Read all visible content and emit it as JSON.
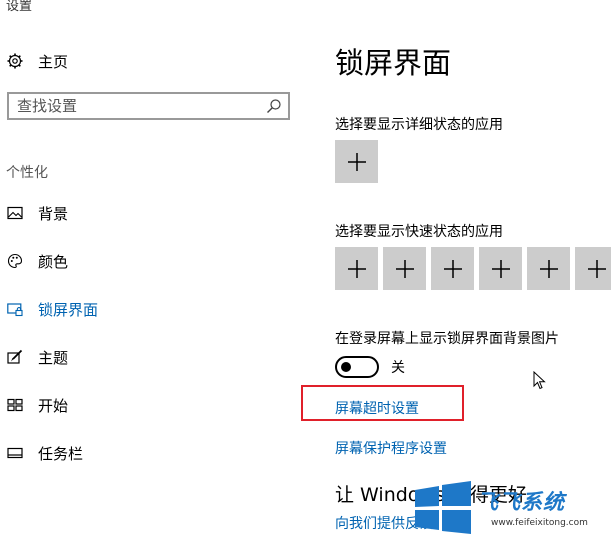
{
  "window": {
    "title": "设置"
  },
  "sidebar": {
    "home_label": "主页",
    "search_placeholder": "查找设置",
    "section_label": "个性化",
    "items": [
      {
        "label": "背景",
        "icon": "picture-icon",
        "active": false
      },
      {
        "label": "颜色",
        "icon": "palette-icon",
        "active": false
      },
      {
        "label": "锁屏界面",
        "icon": "lock-screen-icon",
        "active": true
      },
      {
        "label": "主题",
        "icon": "theme-brush-icon",
        "active": false
      },
      {
        "label": "开始",
        "icon": "start-menu-icon",
        "active": false
      },
      {
        "label": "任务栏",
        "icon": "taskbar-icon",
        "active": false
      }
    ]
  },
  "main": {
    "title": "锁屏界面",
    "detailed_status_label": "选择要显示详细状态的应用",
    "quick_status_label": "选择要显示快速状态的应用",
    "background_toggle_label": "在登录屏幕上显示锁屏界面背景图片",
    "background_toggle_state": "关",
    "screen_timeout_link": "屏幕超时设置",
    "screensaver_link": "屏幕保护程序设置",
    "make_better_heading": "让 Windows 变得更好",
    "feedback_link": "向我们提供反馈"
  },
  "watermark": {
    "brand": "飞飞系统",
    "url": "www.feifeixitong.com"
  },
  "colors": {
    "accent": "#0063b1",
    "tile": "#cccccc",
    "highlight": "#e0202a"
  }
}
